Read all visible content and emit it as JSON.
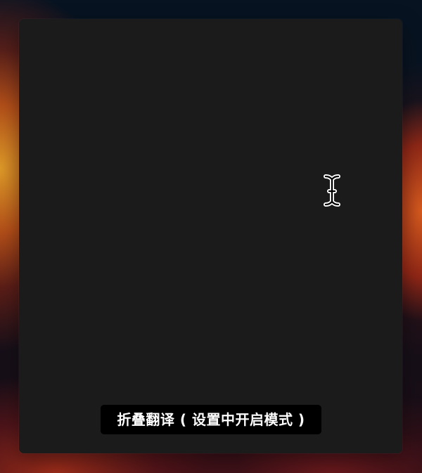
{
  "caption": {
    "text": "折叠翻译 ( 设置中开启模式 )"
  },
  "cursor": {
    "icon": "text-cursor-icon"
  },
  "colors": {
    "panel_background": "#1b1b1b",
    "caption_background": "#000000",
    "caption_text": "#ffffff"
  }
}
